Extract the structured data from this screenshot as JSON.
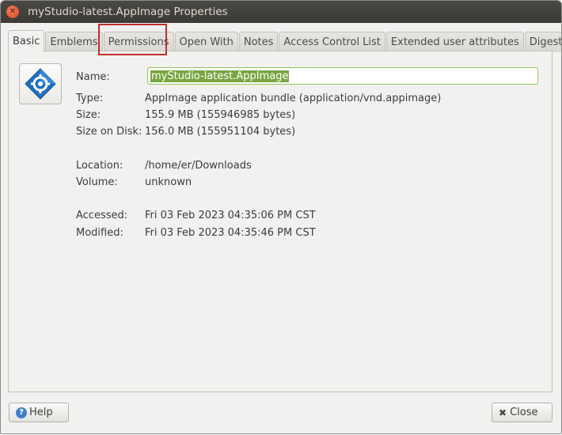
{
  "window": {
    "title": "myStudio-latest.AppImage Properties"
  },
  "tabs": [
    {
      "label": "Basic",
      "active": true
    },
    {
      "label": "Emblems"
    },
    {
      "label": "Permissions"
    },
    {
      "label": "Open With"
    },
    {
      "label": "Notes"
    },
    {
      "label": "Access Control List"
    },
    {
      "label": "Extended user attributes"
    },
    {
      "label": "Digests"
    }
  ],
  "basic": {
    "name_label": "Name:",
    "name_value": "myStudio-latest.AppImage",
    "type_label": "Type:",
    "type_value": "AppImage application bundle (application/vnd.appimage)",
    "size_label": "Size:",
    "size_value": "155.9 MB (155946985 bytes)",
    "disk_label": "Size on Disk:",
    "disk_value": "156.0 MB (155951104 bytes)",
    "location_label": "Location:",
    "location_value": "/home/er/Downloads",
    "volume_label": "Volume:",
    "volume_value": "unknown",
    "accessed_label": "Accessed:",
    "accessed_value": "Fri 03 Feb 2023 04:35:06 PM CST",
    "modified_label": "Modified:",
    "modified_value": "Fri 03 Feb 2023 04:35:46 PM CST"
  },
  "buttons": {
    "help": "Help",
    "close": "Close"
  },
  "icons": {
    "file_icon": "appimage-gear-diamond-icon",
    "help": "help-icon",
    "close": "x-icon",
    "window_close": "window-close-icon"
  }
}
